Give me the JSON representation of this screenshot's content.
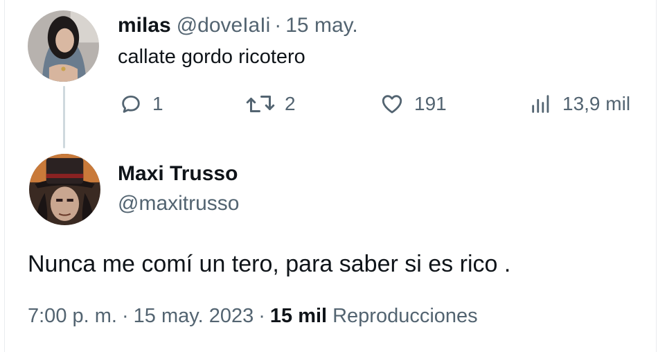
{
  "reply_tweet": {
    "author_name": "milas",
    "author_handle": "@doveIaIi",
    "separator": "·",
    "date": "15 may.",
    "text": "callate gordo ricotero",
    "actions": {
      "replies": "1",
      "reposts": "2",
      "likes": "191",
      "views": "13,9 mil"
    }
  },
  "main_tweet": {
    "author_name": "Maxi Trusso",
    "author_handle": "@maxitrusso",
    "text": "Nunca me comí un tero, para saber si es rico .",
    "time": "7:00 p. m.",
    "separator": "·",
    "date": "15 may. 2023",
    "views_count": "15 mil",
    "views_label": "Reproducciones"
  },
  "icons": {
    "reply": "speech-bubble-icon",
    "repost": "repost-arrows-icon",
    "like": "heart-icon",
    "views": "bar-chart-icon"
  },
  "colors": {
    "text_primary": "#0f1419",
    "text_secondary": "#536471",
    "thread_line": "#cfd9de"
  }
}
